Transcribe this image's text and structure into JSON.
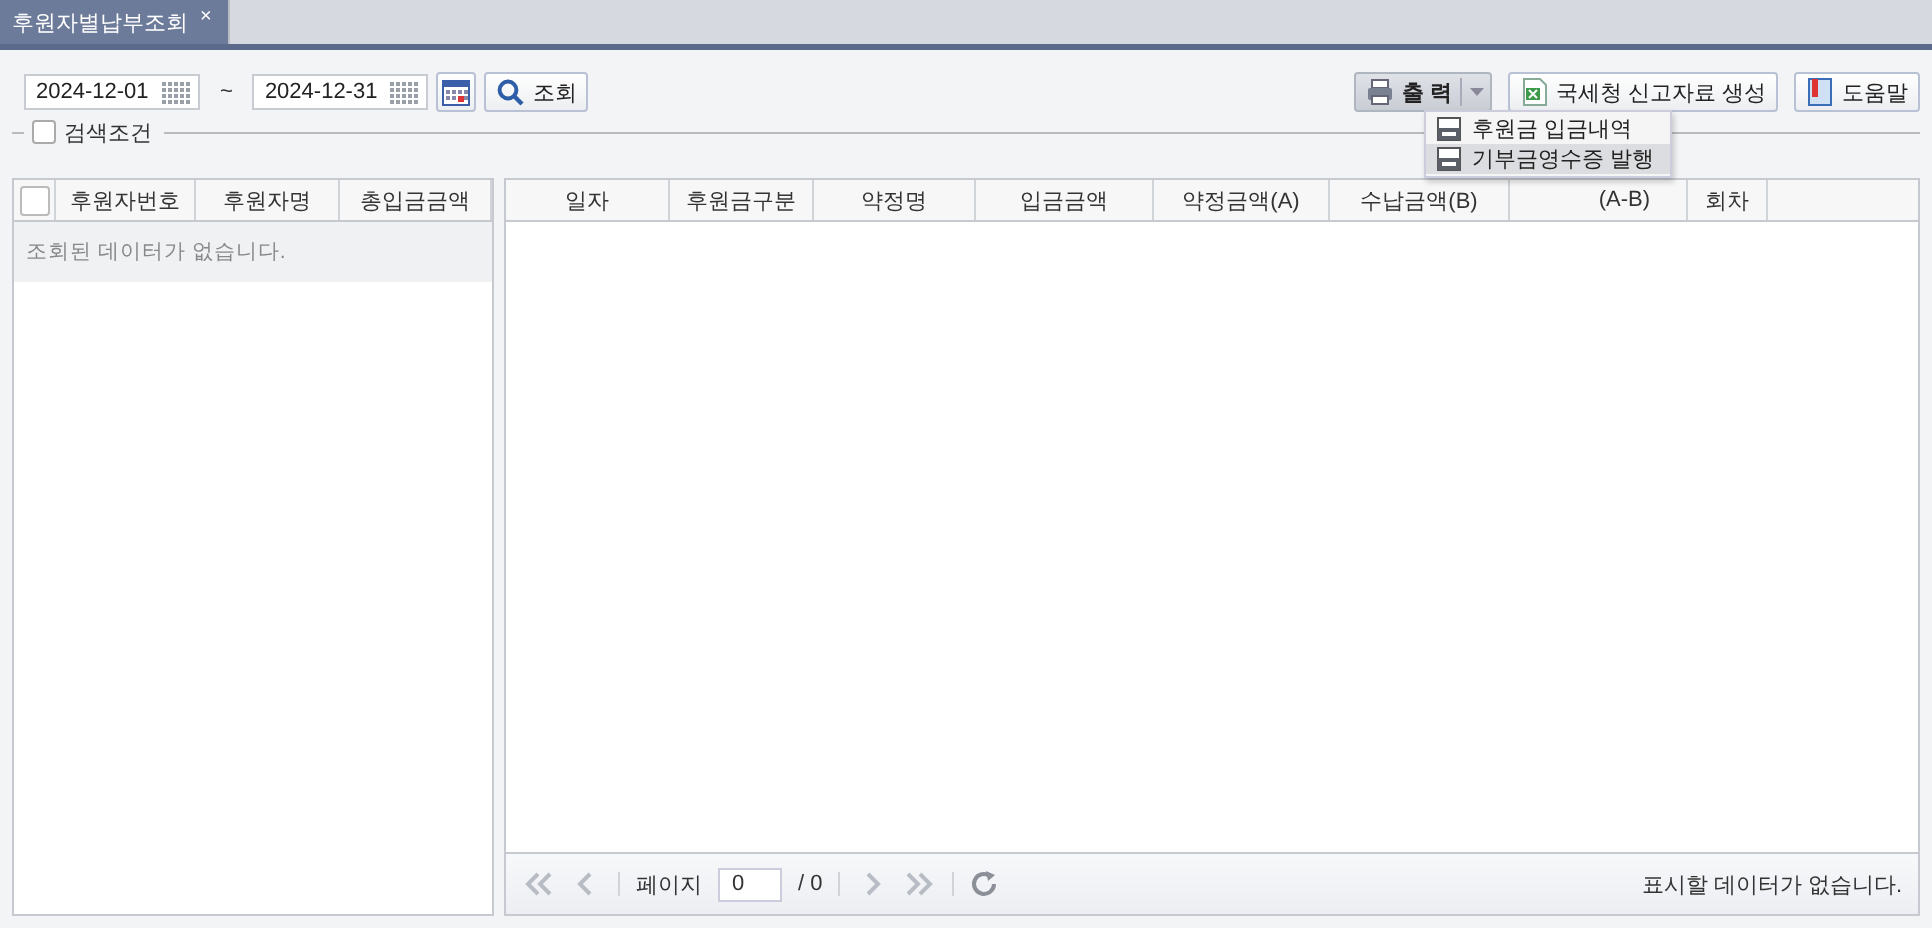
{
  "tabs": [
    {
      "label": "후원자별납부조회",
      "selected": true,
      "close": "×"
    }
  ],
  "toolbar": {
    "date_from": "2024-12-01",
    "separator": "~",
    "date_to": "2024-12-31",
    "search_button": "조회",
    "print_button": "출 력",
    "tax_button": "국세청 신고자료 생성",
    "help_button": "도움말"
  },
  "print_menu": {
    "items": [
      {
        "label": "후원금 입금내역",
        "selected": false
      },
      {
        "label": "기부금영수증 발행",
        "selected": true
      }
    ]
  },
  "search_conditions": {
    "label": "검색조건",
    "checked": false
  },
  "left_grid": {
    "select_all_checked": false,
    "columns": [
      "후원자번호",
      "후원자명",
      "총입금금액"
    ],
    "empty_message": "조회된 데이터가 없습니다."
  },
  "right_grid": {
    "columns": [
      "일자",
      "후원금구분",
      "약정명",
      "입금금액",
      "약정금액(A)",
      "수납금액(B)",
      "(A-B)",
      "회차"
    ]
  },
  "pager": {
    "page_label": "페이지",
    "page_value": "0",
    "page_total": "/ 0",
    "status": "표시할 데이터가 없습니다."
  }
}
